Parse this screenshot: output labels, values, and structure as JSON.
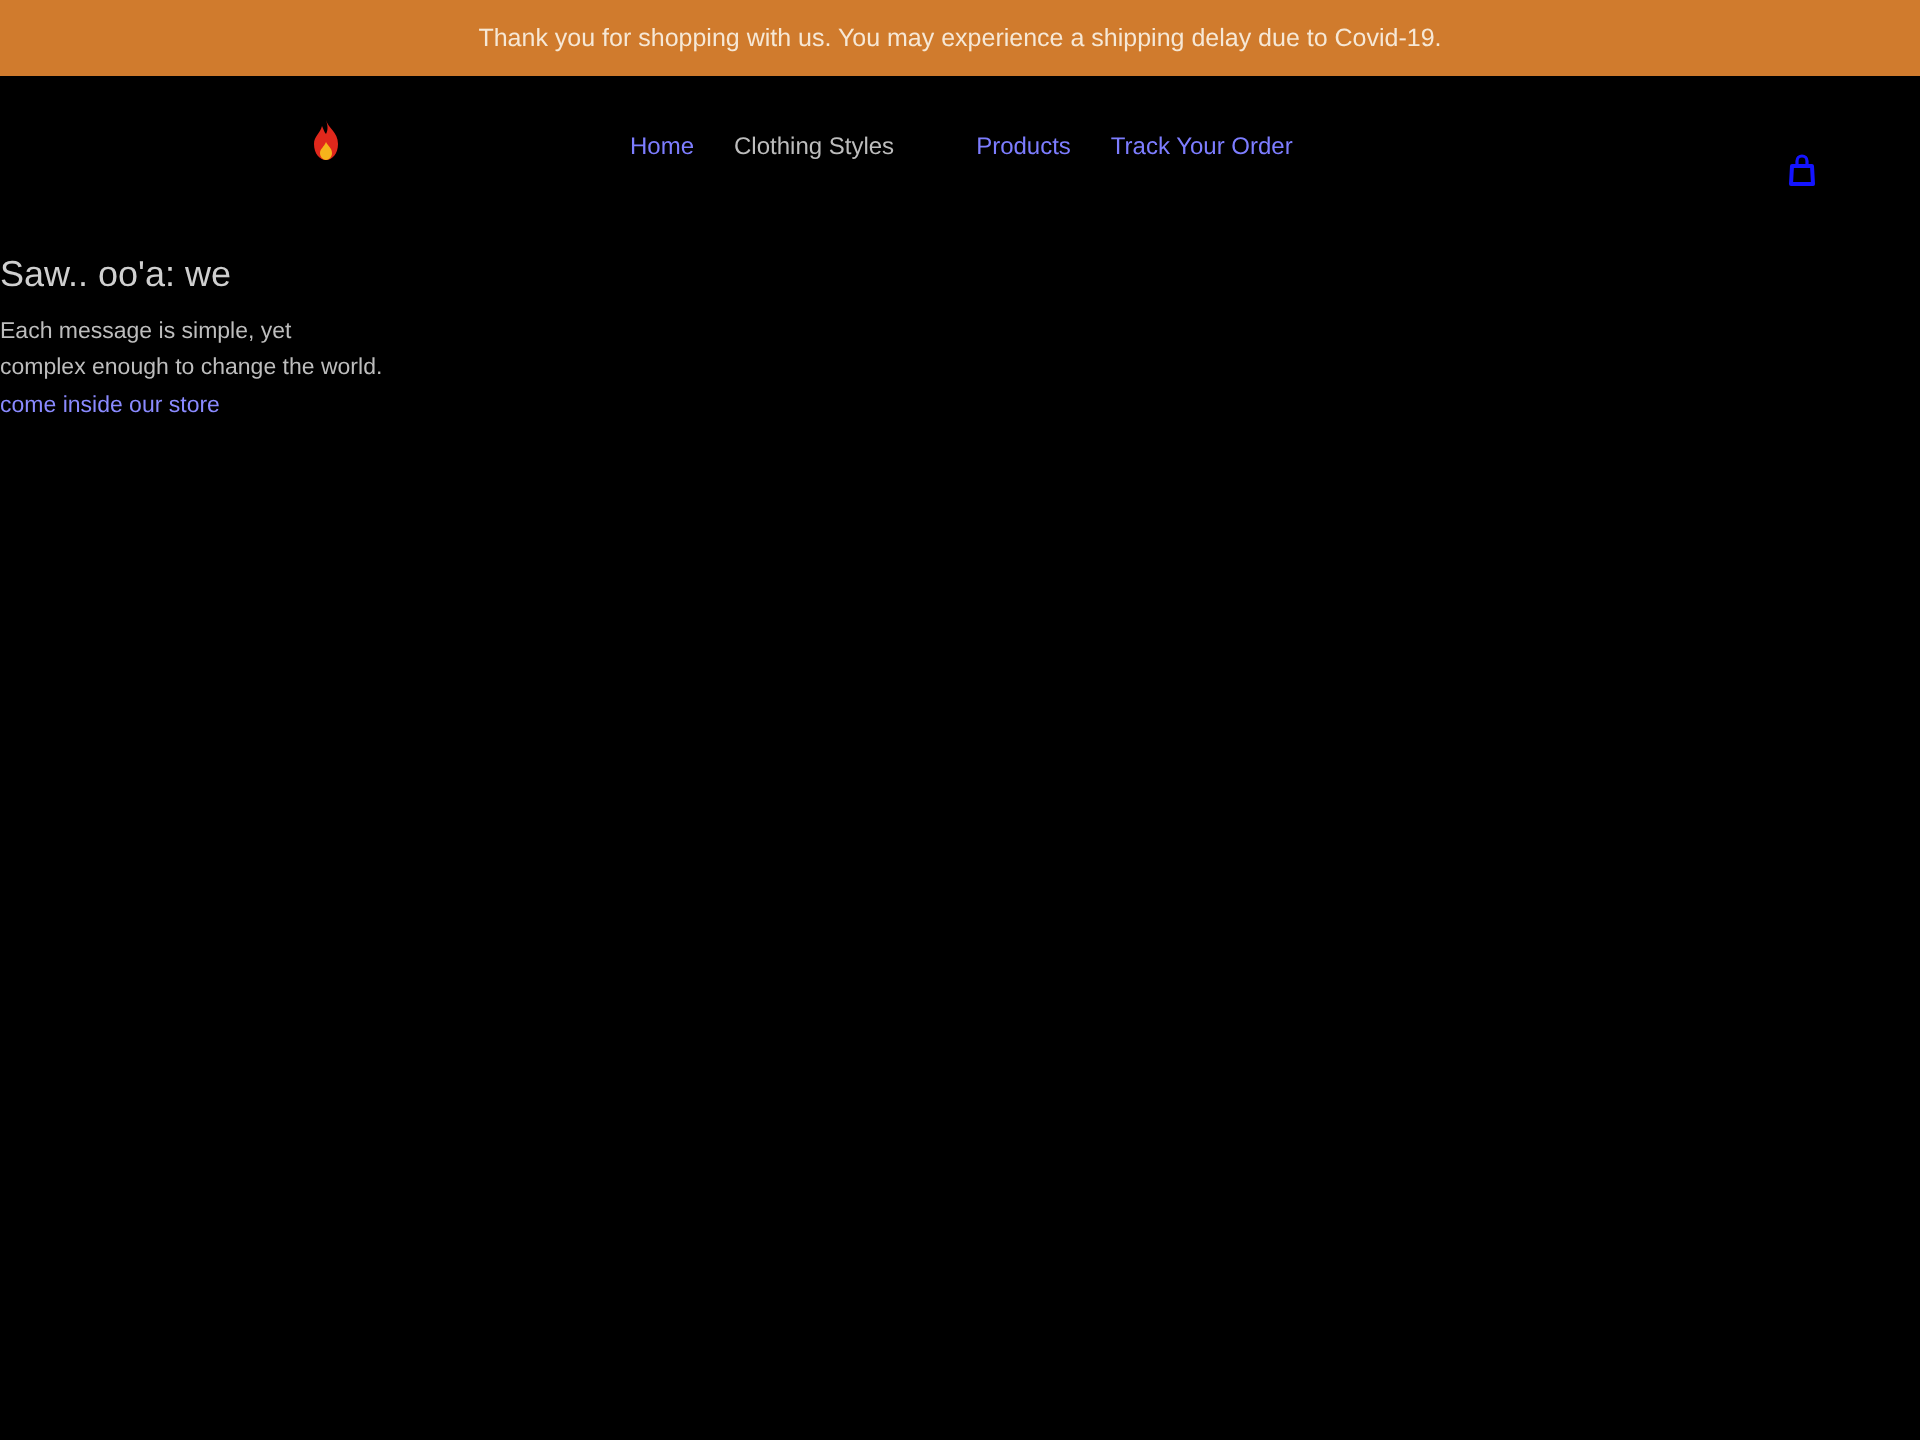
{
  "announcement": {
    "text": "Thank you for shopping with us. You may experience a shipping delay due to Covid-19."
  },
  "header": {
    "nav": [
      {
        "label": "Home",
        "kind": "link"
      },
      {
        "label": "Clothing Styles",
        "kind": "menu"
      },
      {
        "label": "Products",
        "kind": "link"
      },
      {
        "label": "Track Your Order",
        "kind": "link"
      }
    ]
  },
  "hero": {
    "title": "Saw.. oo'a: we",
    "text": "Each message is simple, yet\ncomplex enough to change the world.",
    "link": "come inside our store"
  }
}
